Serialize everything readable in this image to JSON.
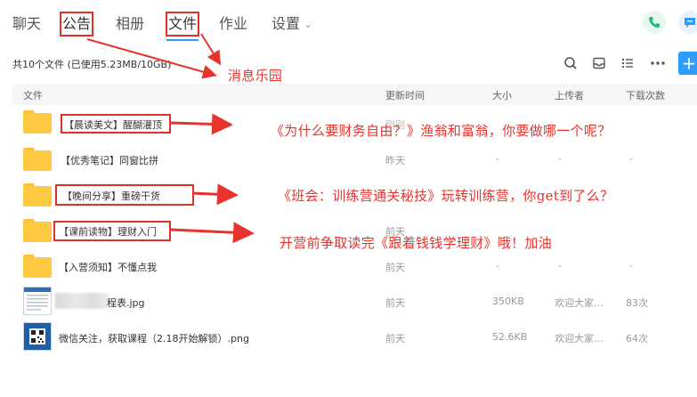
{
  "nav": {
    "tabs": [
      {
        "label": "聊天"
      },
      {
        "label": "公告"
      },
      {
        "label": "相册"
      },
      {
        "label": "文件"
      },
      {
        "label": "作业"
      },
      {
        "label": "设置"
      }
    ],
    "active_tab": "文件"
  },
  "toolbar": {
    "summary": "共10个文件 (已使用5.23MB/10GB)",
    "icons": [
      "search-icon",
      "inbox-icon",
      "list-view-icon",
      "more-icon",
      "add-icon"
    ],
    "add_label": "+"
  },
  "table": {
    "columns": {
      "name": "文件",
      "updated": "更新时间",
      "size": "大小",
      "uploader": "上传者",
      "downloads": "下载次数"
    },
    "rows": [
      {
        "type": "folder",
        "name": "【晨读美文】醒醐灌顶",
        "updated": "刚刚",
        "size": "",
        "uploader": "",
        "downloads": ""
      },
      {
        "type": "folder",
        "name": "【优秀笔记】同窗比拼",
        "updated": "昨天",
        "size": "-",
        "uploader": "-",
        "downloads": "-"
      },
      {
        "type": "folder",
        "name": "【晚间分享】重磅干货",
        "updated": "",
        "size": "",
        "uploader": "",
        "downloads": ""
      },
      {
        "type": "folder",
        "name": "【课前读物】理财入门",
        "updated": "前天",
        "size": "-",
        "uploader": "-",
        "downloads": "-"
      },
      {
        "type": "folder",
        "name": "【入营须知】不懂点我",
        "updated": "前天",
        "size": "-",
        "uploader": "-",
        "downloads": "-"
      },
      {
        "type": "file",
        "name": "程表.jpg",
        "updated": "前天",
        "size": "350KB",
        "uploader": "欢迎大家...",
        "downloads": "83次"
      },
      {
        "type": "file",
        "name": "微信关注，获取课程（2.18开始解锁）.png",
        "updated": "前天",
        "size": "52.6KB",
        "uploader": "欢迎大家...",
        "downloads": "64次"
      }
    ]
  },
  "annotations": {
    "nav_note": "消息乐园",
    "row1_note": "《为什么要财务自由？》渔翁和富翁，你要做哪一个呢？",
    "row3_note": "《班会：训练营通关秘技》玩转训练营，你get到了么？",
    "row4_note": "开营前争取读完《跟着钱钱学理财》哦！加油"
  },
  "colors": {
    "accent": "#2d9cff",
    "annotation_red": "#e8322c",
    "folder_yellow": "#ffca42",
    "phone_green": "#19c07c"
  }
}
